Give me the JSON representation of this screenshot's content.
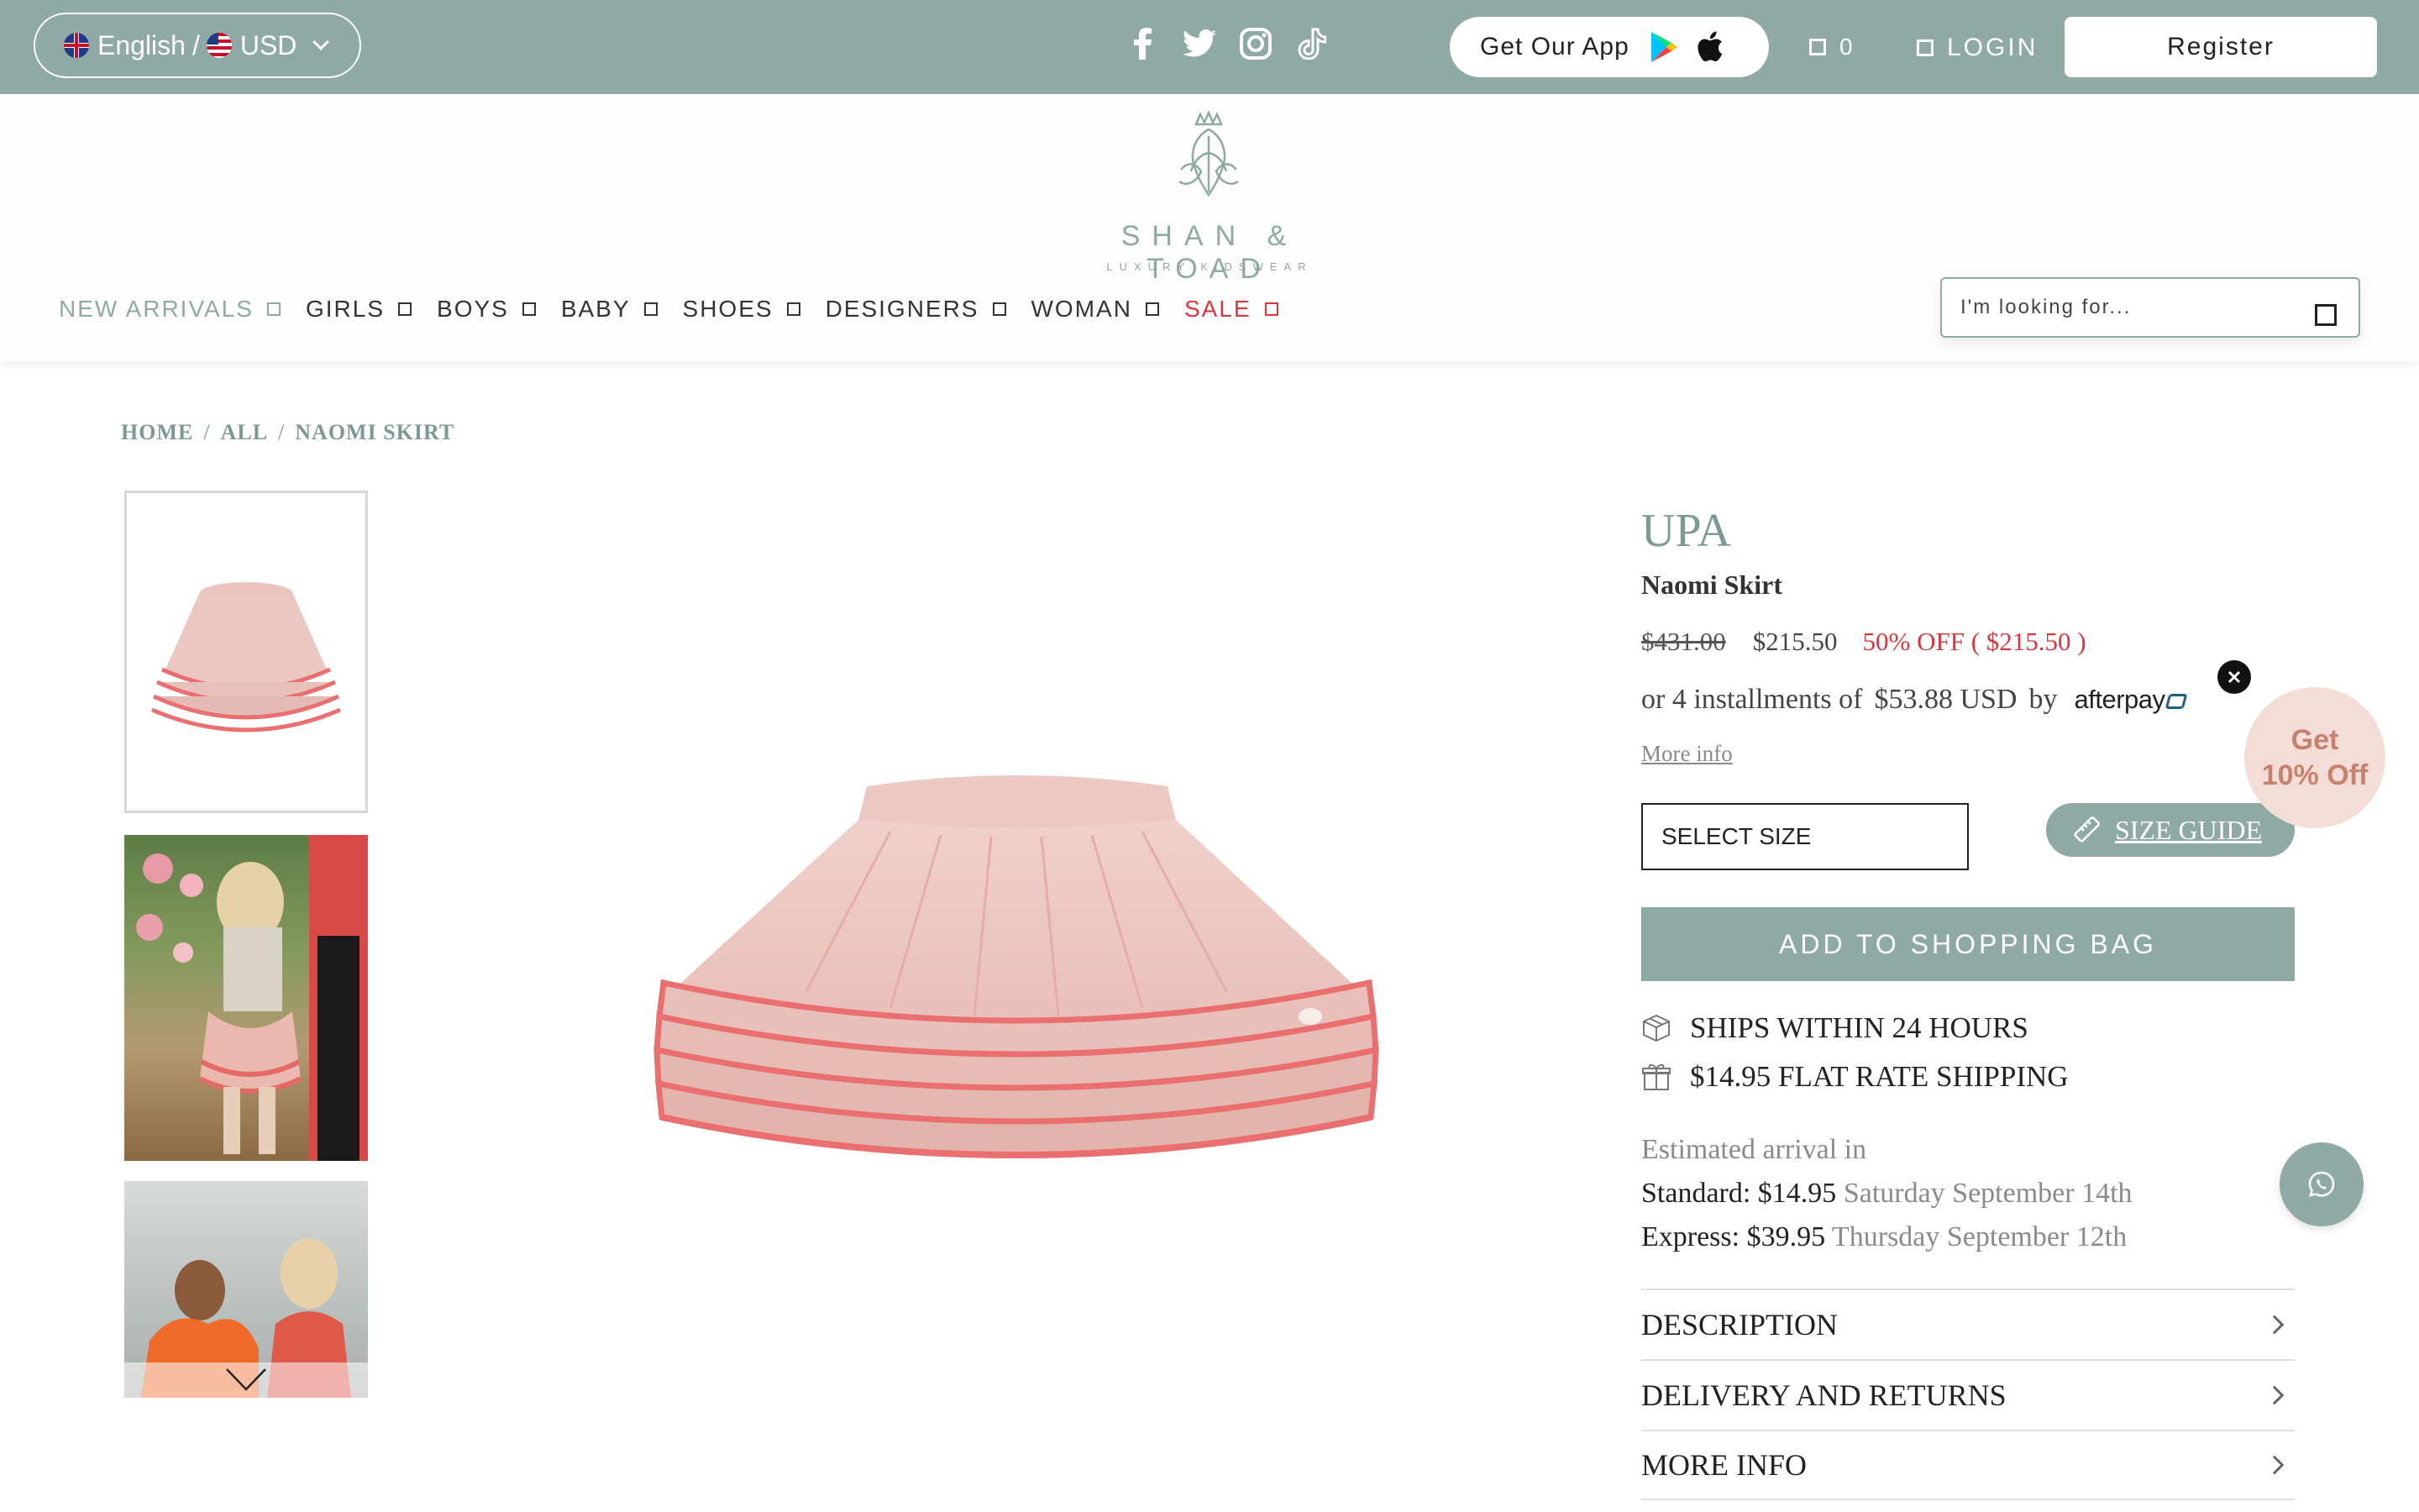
{
  "topbar": {
    "language": "English",
    "separator": "/",
    "currency": "USD",
    "social_icons": [
      "facebook-icon",
      "twitter-icon",
      "instagram-icon",
      "tiktok-icon"
    ],
    "app_label": "Get Our App",
    "cart_count": "0",
    "login_label": "LOGIN",
    "register_label": "Register"
  },
  "header": {
    "logo_name": "SHAN & TOAD",
    "logo_tagline": "LUXURY KIDSWEAR",
    "nav": [
      "NEW ARRIVALS",
      "GIRLS",
      "BOYS",
      "BABY",
      "SHOES",
      "DESIGNERS",
      "WOMAN",
      "SALE"
    ],
    "search_placeholder": "I'm looking for..."
  },
  "breadcrumb": [
    "HOME",
    "ALL",
    "NAOMI SKIRT"
  ],
  "product": {
    "brand": "UPA",
    "name": "Naomi Skirt",
    "old_price": "$431.00",
    "price": "$215.50",
    "discount": "50% OFF ( $215.50 )",
    "installments_prefix": "or 4 installments of",
    "installment_amount": "$53.88 USD",
    "installments_by": "by",
    "afterpay_label": "afterpay",
    "more_info": "More info",
    "select_size": "SELECT SIZE",
    "size_guide": "SIZE GUIDE",
    "add_to_bag": "ADD TO SHOPPING BAG",
    "ships": "SHIPS WITHIN 24 HOURS",
    "flat_rate": "$14.95 FLAT RATE SHIPPING",
    "estimated_label": "Estimated arrival in",
    "standard_label": "Standard: $14.95",
    "standard_date": "Saturday September 14th",
    "express_label": "Express: $39.95",
    "express_date": "Thursday September 12th",
    "accordion": [
      "DESCRIPTION",
      "DELIVERY AND RETURNS",
      "MORE INFO"
    ]
  },
  "promo": {
    "line1": "Get",
    "line2": "10% Off"
  },
  "colors": {
    "brand": "#8fa9a4",
    "sale": "#d9363e",
    "promo_bg": "#f3ddd6",
    "promo_text": "#c8816e"
  }
}
